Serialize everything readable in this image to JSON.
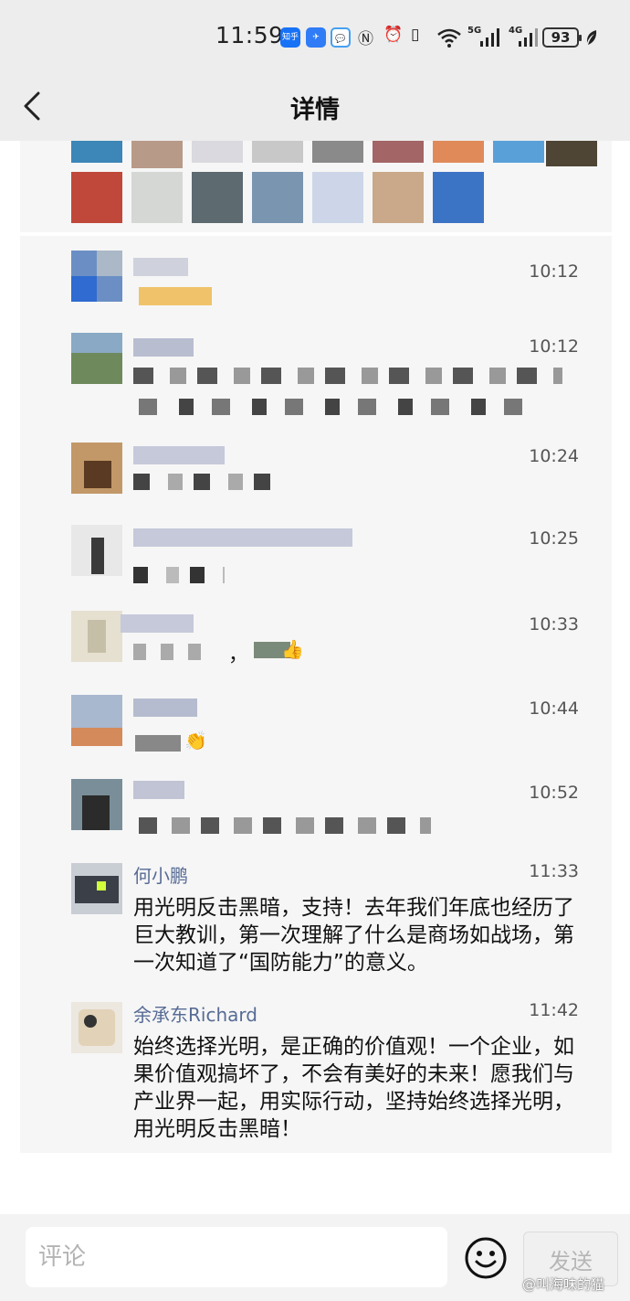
{
  "status_bar": {
    "time": "11:59",
    "app_icons": [
      "知乎",
      "✈",
      "💬"
    ],
    "network_5g": "5G",
    "network_4g": "4G",
    "battery": "93"
  },
  "nav": {
    "title": "详情"
  },
  "comments": [
    {
      "time": "10:12"
    },
    {
      "time": "10:12"
    },
    {
      "time": "10:24"
    },
    {
      "time": "10:25"
    },
    {
      "time": "10:33",
      "visible_text": "，",
      "emoji": "👍"
    },
    {
      "time": "10:44",
      "emoji": "👏"
    },
    {
      "time": "10:52"
    },
    {
      "name": "何小鹏",
      "time": "11:33",
      "text": "用光明反击黑暗，支持！去年我们年底也经历了巨大教训，第一次理解了什么是商场如战场，第一次知道了“国防能力”的意义。"
    },
    {
      "name": "余承东Richard",
      "time": "11:42",
      "text": "始终选择光明，是正确的价值观！一个企业，如果价值观搞坏了，不会有美好的未来！愿我们与产业界一起，用实际行动，坚持始终选择光明，用光明反击黑暗！"
    }
  ],
  "input_bar": {
    "placeholder": "评论",
    "send_label": "发送"
  },
  "watermark": "@叫海味的猫",
  "colors": {
    "name_link": "#576b95",
    "panel_bg": "#f6f6f6",
    "bar_bg": "#ededed"
  }
}
